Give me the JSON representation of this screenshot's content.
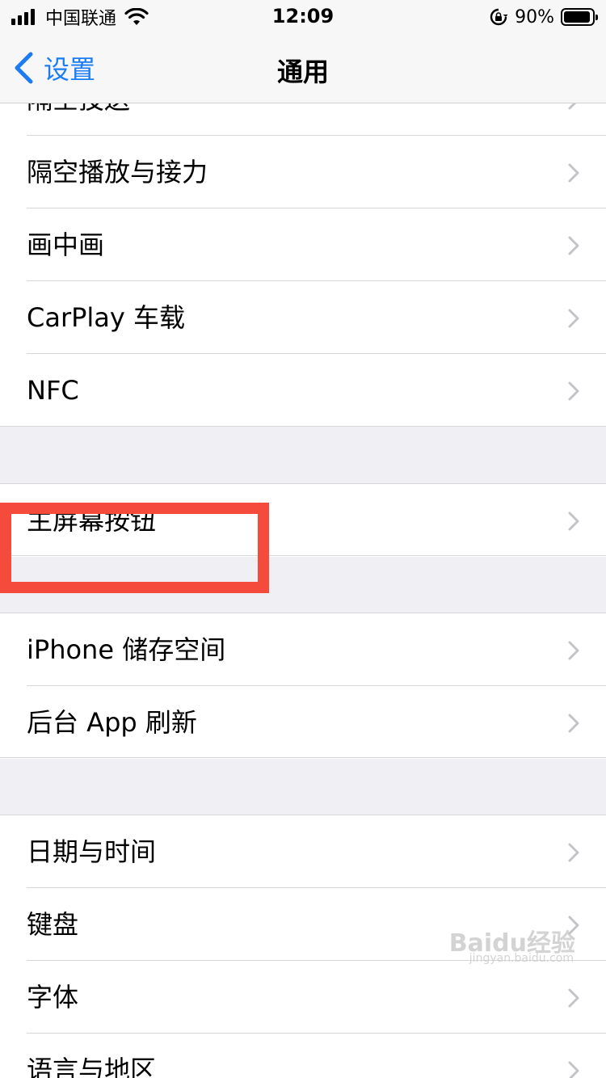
{
  "status_bar": {
    "carrier": "中国联通",
    "time": "12:09",
    "battery_percent": "90%",
    "battery_level": 0.9,
    "icons": [
      "signal-icon",
      "wifi-icon",
      "rotation-lock-icon",
      "battery-icon"
    ]
  },
  "nav": {
    "back_label": "设置",
    "title": "通用",
    "accent_color": "#1b7cf5"
  },
  "groups": [
    {
      "items": [
        {
          "label": "隔空投送"
        },
        {
          "label": "隔空播放与接力"
        },
        {
          "label": "画中画"
        },
        {
          "label": "CarPlay 车载"
        },
        {
          "label": "NFC"
        }
      ]
    },
    {
      "items": [
        {
          "label": "主屏幕按钮"
        }
      ]
    },
    {
      "items": [
        {
          "label": "iPhone 储存空间",
          "highlighted": true
        },
        {
          "label": "后台 App 刷新"
        }
      ]
    },
    {
      "items": [
        {
          "label": "日期与时间"
        },
        {
          "label": "键盘"
        },
        {
          "label": "字体"
        },
        {
          "label": "语言与地区"
        }
      ]
    }
  ],
  "highlight_color": "#f44b3c",
  "watermark": {
    "text": "Baidu经验",
    "sub": "jingyan.baidu.com"
  }
}
